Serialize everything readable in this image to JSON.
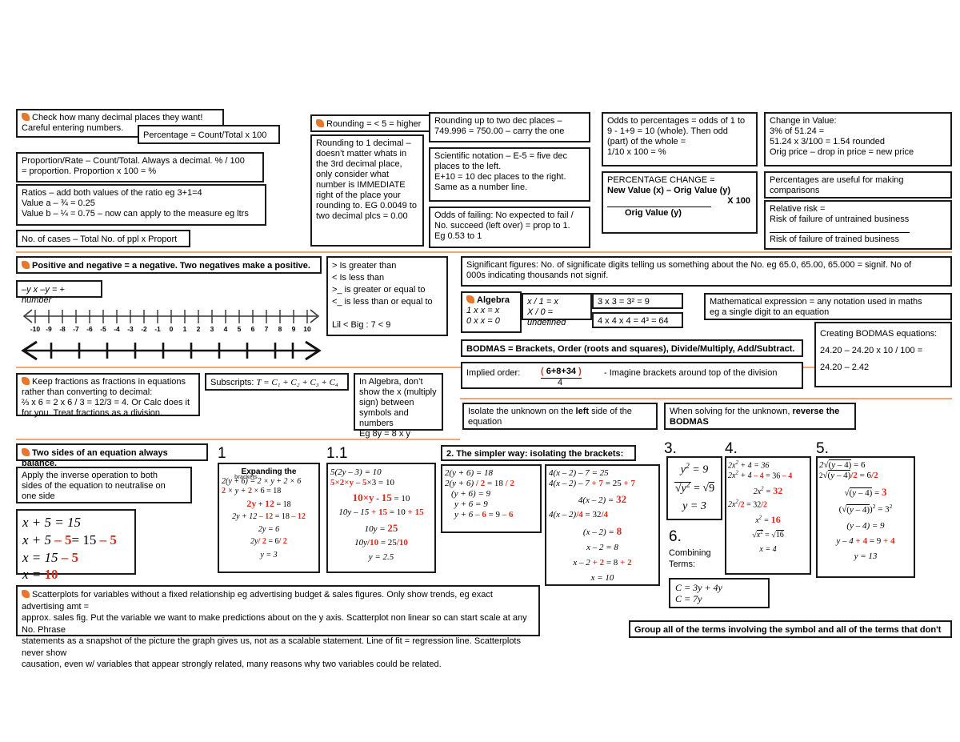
{
  "colors": {
    "accent": "#E8762C",
    "red": "#d92b1c",
    "border": "#1a1a1a",
    "divider": "#F0A875"
  },
  "section1": {
    "decimal_places": {
      "line1": "Check how many decimal places they want!",
      "line2": "Careful entering numbers."
    },
    "percentage_formula": "Percentage = Count/Total x 100",
    "proportion": {
      "line1": "Proportion/Rate – Count/Total. Always a decimal. % / 100",
      "line2": "= proportion. Proportion x 100 = %"
    },
    "ratios": {
      "line1": "Ratios – add both values of the ratio eg 3+1=4",
      "line2": "Value a – ¾ = 0.25",
      "line3": "Value b – ¼ = 0.75 – now can apply to the measure eg ltrs"
    },
    "cases": "No. of cases – Total No. of ppl x Proport"
  },
  "section2": {
    "rounding_rule": "Rounding = < 5 = higher",
    "rounding_one_dec": "Rounding to 1 decimal – doesn’t matter whats in the 3rd decimal place, only consider what number is IMMEDIATE right of the place your rounding to. EG 0.0049 to two decimal plcs = 0.00",
    "rounding_two_dec": {
      "line1": "Rounding up to two dec places –",
      "line2": "749.996 = 750.00 – carry the one"
    },
    "scientific": {
      "line1": "Scientific notation – E-5 = five dec",
      "line2": "places to the left.",
      "line3": "E+10 = 10 dec places to the right.",
      "line4": "Same as a number line."
    },
    "odds_failing": {
      "line1": "Odds of failing: No expected to fail /",
      "line2": "No. succeed (left over) = prop to 1.",
      "line3": "Eg 0.53 to 1"
    },
    "odds_percent": {
      "line1": "Odds to percentages = odds of 1 to",
      "line2": "9 - 1+9 = 10 (whole). Then odd",
      "line3": "(part) of the whole =",
      "line4": "1/10 x 100 = %"
    },
    "percentage_change": {
      "title": "PERCENTAGE CHANGE =",
      "numerator": "New Value (x) – Orig Value (y)",
      "denominator": "Orig Value (y)",
      "multiplier": "X 100"
    },
    "change_in_value": {
      "line1": "Change in Value:",
      "line2": "3% of 51.24 =",
      "line3": "51.24 x 3/100 = 1.54 rounded",
      "line4": "Orig price – drop in price = new price"
    },
    "percent_useful": {
      "line1": "Percentages are useful for making",
      "line2": "comparisons"
    },
    "relative_risk": {
      "line1": "Relative risk =",
      "line2": "Risk of failure of untrained business",
      "line3": "Risk of failure of trained business"
    }
  },
  "section3": {
    "pos_neg": "Positive and negative = a negative. Two negatives make a positive.",
    "neg_formula": "–y x –y = + number",
    "numberline_ticks": [
      "-10",
      "-9",
      "-8",
      "-7",
      "-6",
      "-5",
      "-4",
      "-3",
      "-2",
      "-1",
      "0",
      "1",
      "2",
      "3",
      "4",
      "5",
      "6",
      "7",
      "8",
      "9",
      "10"
    ],
    "inequalities": {
      "line1": "> Is greater than",
      "line2": "< Is less than",
      "line3": ">_ is greater or equal to",
      "line4": "<_ is less than or equal to",
      "line5": "Lil < Big : 7 < 9"
    },
    "sig_figures": {
      "line1": "Significant figures: No. of significate digits telling us something about the No. eg 65.0, 65.00, 65.000 = signif. No of",
      "line2": "000s indicating thousands not signif."
    },
    "algebra": {
      "title": "Algebra",
      "line1": "1 x x = x",
      "line2": "0 x  x = 0"
    },
    "algebra_div": {
      "line1": "x / 1 = x",
      "line2": "X / 0 = undefined"
    },
    "powers1": "3 x 3 = 3² = 9",
    "powers2": "4 x 4 x 4 = 4³ = 64",
    "math_expression": {
      "line1": "Mathematical expression = any notation used in maths",
      "line2": "eg a single digit to an equation"
    },
    "bodmas": "BODMAS = Brackets, Order (roots and squares), Divide/Multiply, Add/Subtract.",
    "implied_order": {
      "label": "Implied order:",
      "numerator": "( 6+8+34 )",
      "denominator": "4",
      "note": "- Imagine brackets around top of the division"
    },
    "creating_bodmas": {
      "line1": "Creating BODMAS equations:",
      "line2": "24.20 – 24.20 x 10 / 100 =",
      "line3": "24.20 – 2.42"
    }
  },
  "section4": {
    "fractions": {
      "line1": "Keep fractions as fractions in equations",
      "line2": "rather than converting to decimal:",
      "line3": "⅔ x 6 = 2 x 6 / 3 = 12/3 = 4. Or Calc does it",
      "line4": "for you. Treat fractions as a division."
    },
    "subscripts": {
      "label": "Subscripts:",
      "formula": "T = C₁ + C₂ + C₃ + C₄"
    },
    "no_times_sign": {
      "line1": "In Algebra, don’t",
      "line2": "show the x (multiply",
      "line3": "sign) between",
      "line4": "symbols and numbers",
      "line5": "Eg 8y = 8 x  y"
    },
    "isolate": {
      "pre": "Isolate the unknown on the ",
      "bold": "left",
      "post": " side of the equation"
    },
    "reverse": {
      "pre": "When solving for the unknown, ",
      "bold": "reverse the BODMAS"
    }
  },
  "section5": {
    "balance": "Two sides of an equation always balance.",
    "inverse": {
      "line1": "Apply the inverse operation to both",
      "line2": "sides of the equation to neutralise on",
      "line3": "one side"
    },
    "example_simple": {
      "l1": "x + 5 = 15",
      "l2a": "x + 5 ",
      "l2b": "– 5",
      "l2c": "= 15 ",
      "l2d": "– 5",
      "l3a": "x = 15 ",
      "l3b": "– 5",
      "l4a": "x = ",
      "l4b": "10"
    },
    "step1": {
      "num": "1",
      "title": "Expanding the",
      "title2": "brackets",
      "l1": "2(y + 6) = 2 × y + 2 × 6",
      "l2a": "2",
      "l2b": " × y + ",
      "l2c": "2",
      "l2d": " × 6 = 18",
      "l3a": "2y",
      "l3b": " + ",
      "l3c": "12",
      "l3d": " = 18",
      "l4a": "2y + 12 ",
      "l4b": "– 12",
      "l4c": " = 18 ",
      "l4d": "– 12",
      "l5": "2y = 6",
      "l6a": "2y",
      "l6b": "/ 2",
      "l6c": " = 6",
      "l6d": "/ 2",
      "l7": "y = 3"
    },
    "step11": {
      "num": "1.1",
      "l1": "5(2y – 3) = 10",
      "l2a": "5×2×y",
      "l2b": " – ",
      "l2c": "5",
      "l2d": "×3 = 10",
      "l3a": "10×y",
      "l3b": " - ",
      "l3c": "15",
      "l3d": " = 10",
      "l4a": "10y – 15 ",
      "l4b": "+ 15",
      "l4c": " = 10 ",
      "l4d": "+ 15",
      "l5a": "10y = ",
      "l5b": "25",
      "l6a": "10y",
      "l6b": "/10",
      "l6c": " = 25",
      "l6d": "/10",
      "l7": "y = 2.5"
    },
    "step2": {
      "title": "2. The simpler way: isolating the brackets:",
      "l1": "2(y + 6) = 18",
      "l2a": "2(y + 6) ",
      "l2b": "/ 2",
      "l2c": " = 18 ",
      "l2d": "/ 2",
      "l3": "(y + 6) = 9",
      "l4": "y + 6 = 9",
      "l5a": "y + 6 ",
      "l5b": "– 6",
      "l5c": " = 9 ",
      "l5d": "– 6"
    },
    "step2b": {
      "l1": "4(x – 2) – 7 = 25",
      "l2a": "4(x – 2) – 7 ",
      "l2b": "+ 7",
      "l2c": " = 25 ",
      "l2d": "+ 7",
      "l3a": "4(x – 2) = ",
      "l3b": "32",
      "l4a": "4(x – 2)",
      "l4b": "/4",
      "l4c": " = 32",
      "l4d": "/4",
      "l5a": "(x – 2)  = ",
      "l5b": "8",
      "l6": "x – 2  = 8",
      "l7a": "x – 2 ",
      "l7b": "+ 2",
      "l7c": " = 8 ",
      "l7d": "+ 2",
      "l8": "x = 10"
    },
    "step3": {
      "num": "3.",
      "l1": "y² = 9",
      "l2": "√y² = √9",
      "l3": "y = 3"
    },
    "step4": {
      "num": "4.",
      "l1": "2x² + 4 = 36",
      "l2a": "2x² + 4 ",
      "l2b": "– 4",
      "l2c": " = 36 ",
      "l2d": "– 4",
      "l3a": "2x² = ",
      "l3b": "32",
      "l4a": "2x²",
      "l4b": "/2",
      "l4c": " = 32",
      "l4d": "/2",
      "l5a": "x² = ",
      "l5b": "16",
      "l6": "√x² = √16",
      "l7": "x = 4"
    },
    "step5": {
      "num": "5.",
      "l1": "2√(y – 4) = 6",
      "l2a": "2√(y – 4)",
      "l2b": "/2",
      "l2c": " = 6",
      "l2d": "/2",
      "l3a": "√(y – 4) = ",
      "l3b": "3",
      "l4": "(√(y – 4))² = 3²",
      "l5": "(y – 4) = 9",
      "l6a": "y – 4 ",
      "l6b": "+ 4",
      "l6c": " = 9 ",
      "l6d": "+ 4",
      "l7": "y = 13"
    },
    "step6": {
      "num": "6.",
      "label1": "Combining",
      "label2": "Terms:",
      "l1": "C = 3y + 4y",
      "l2": "C = 7y"
    },
    "scatterplots": {
      "line1": "Scatterplots for variables without a fixed relationship eg advertising budget & sales figures. Only show trends, eg exact advertising amt =",
      "line2": "approx. sales fig. Put the variable we want to make predictions about on the y axis. Scatterplot non linear so can start scale at any No. Phrase",
      "line3": "statements as a snapshot of the picture the graph gives us, not as a scalable statement. Line of fit = regression line. Scatterplots never show",
      "line4": "causation, even w/ variables that appear strongly related, many reasons why two variables could be related."
    },
    "group_terms": "Group all of the terms involving the symbol and all of the terms that don't"
  }
}
